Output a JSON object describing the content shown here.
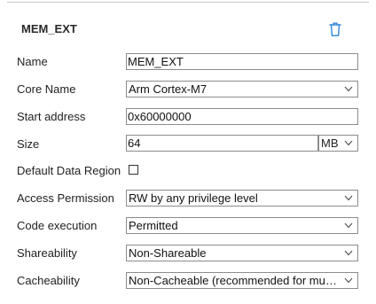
{
  "section": {
    "title": "MEM_EXT"
  },
  "icons": {
    "delete": "trash-icon",
    "dropdown": "chevron-down-icon"
  },
  "colors": {
    "accent": "#2e86d6",
    "field_border": "#8c8c8c"
  },
  "fields": {
    "name": {
      "label": "Name",
      "value": "MEM_EXT"
    },
    "core_name": {
      "label": "Core Name",
      "value": "Arm Cortex-M7"
    },
    "start_address": {
      "label": "Start address",
      "value": "0x60000000"
    },
    "size": {
      "label": "Size",
      "value": "64",
      "unit": "MB"
    },
    "default_data_region": {
      "label": "Default Data Region",
      "checked": false
    },
    "access_permission": {
      "label": "Access Permission",
      "value": "RW by any privilege level"
    },
    "code_execution": {
      "label": "Code execution",
      "value": "Permitted"
    },
    "shareability": {
      "label": "Shareability",
      "value": "Non-Shareable"
    },
    "cacheability": {
      "label": "Cacheability",
      "value": "Non-Cacheable (recommended for multi…"
    }
  }
}
